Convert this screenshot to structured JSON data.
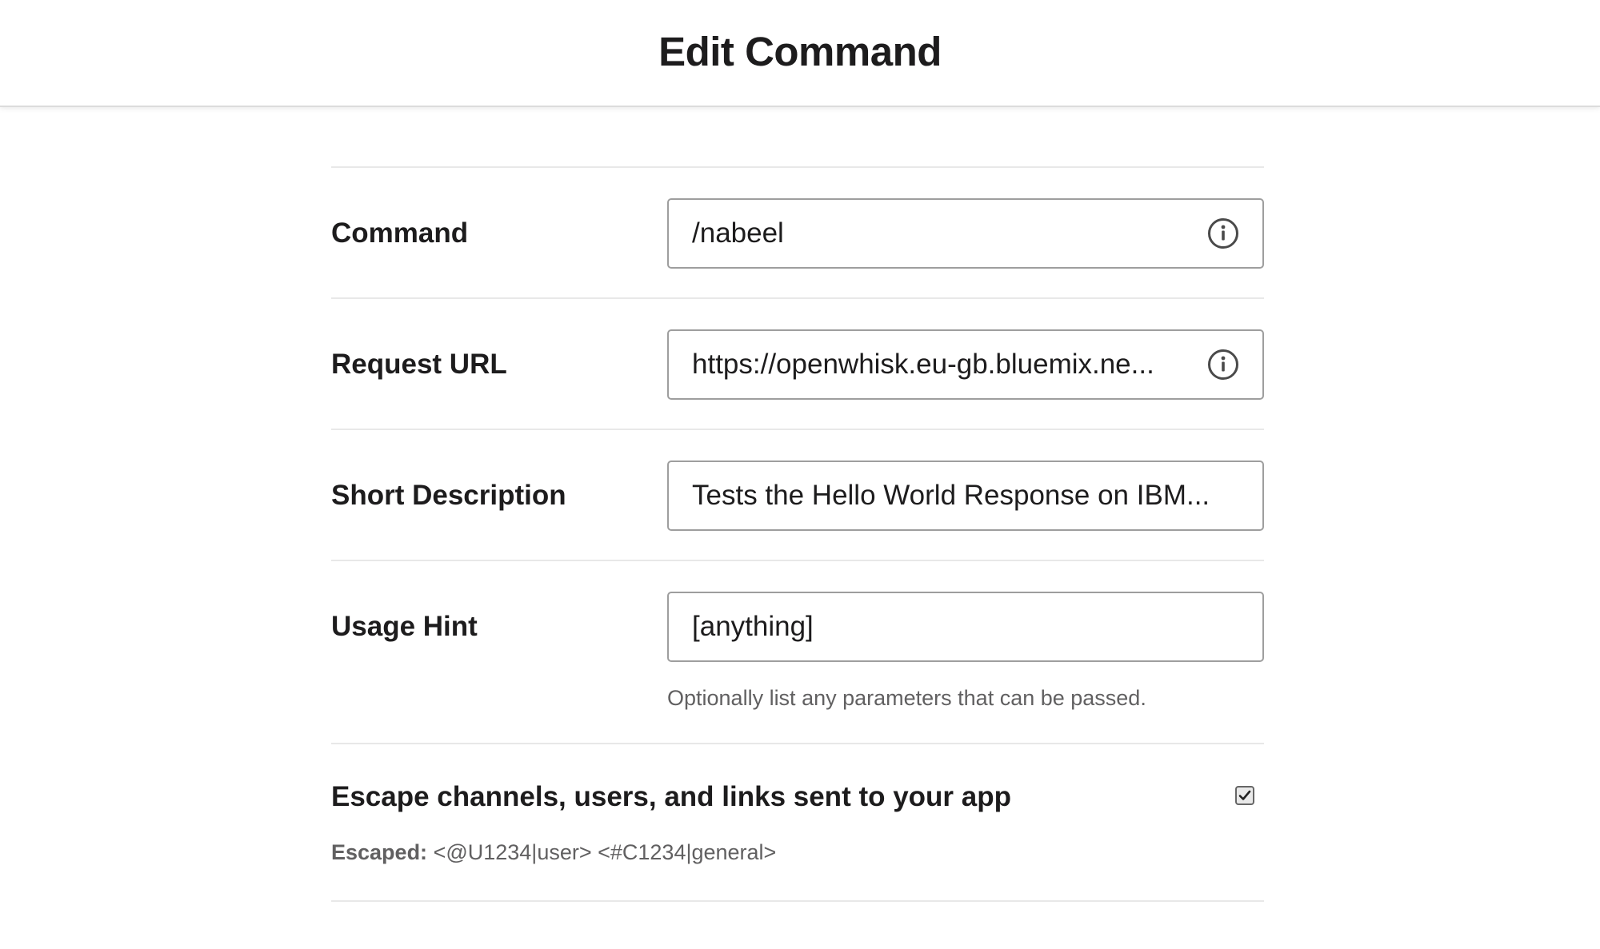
{
  "header": {
    "title": "Edit Command"
  },
  "form": {
    "command": {
      "label": "Command",
      "value": "/nabeel",
      "icon": "info-icon"
    },
    "request_url": {
      "label": "Request URL",
      "value": "https://openwhisk.eu-gb.bluemix.ne...",
      "icon": "info-icon"
    },
    "short_description": {
      "label": "Short Description",
      "value": "Tests the Hello World Response on IBM..."
    },
    "usage_hint": {
      "label": "Usage Hint",
      "value": "[anything]",
      "helper": "Optionally list any parameters that can be passed."
    },
    "escape": {
      "label": "Escape channels, users, and links sent to your app",
      "checked": true,
      "escaped_key": "Escaped:",
      "escaped_value": " <@U1234|user> <#C1234|general>"
    }
  },
  "colors": {
    "text": "#1d1c1d",
    "muted": "#616061",
    "border": "#9e9e9e",
    "divider": "#e8e8e8"
  }
}
